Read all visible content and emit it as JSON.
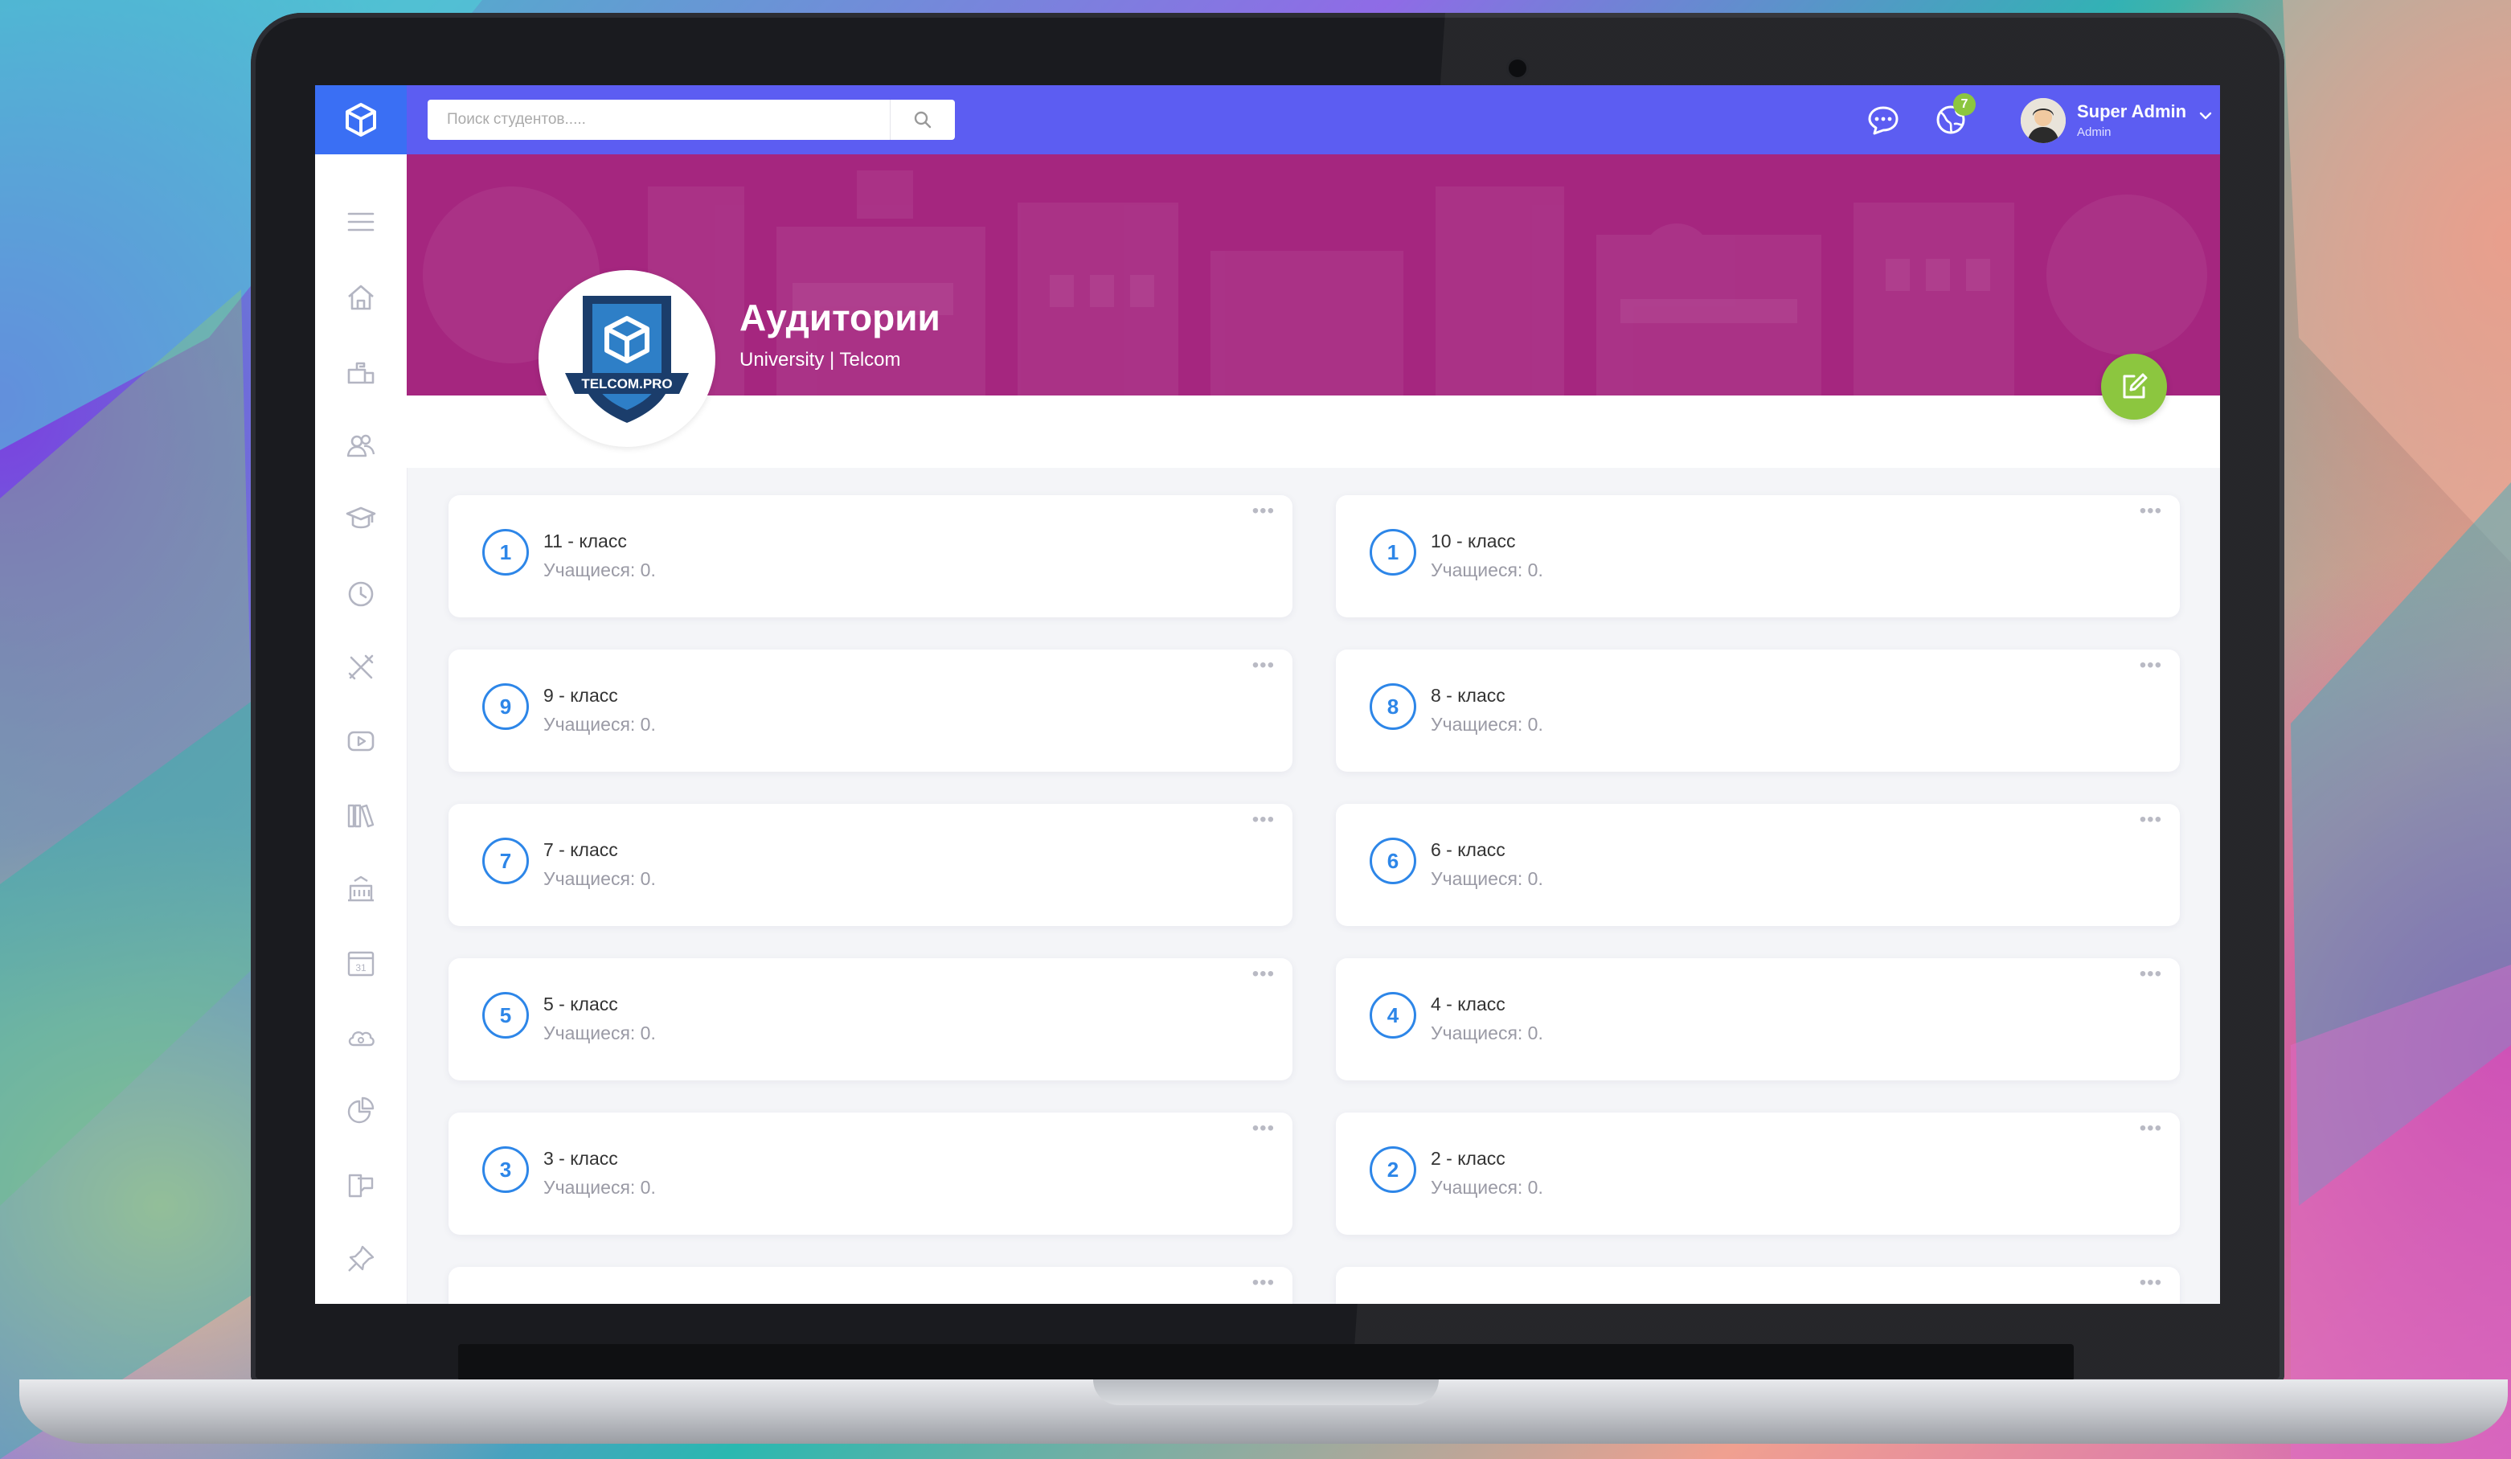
{
  "topbar": {
    "search_placeholder": "Поиск студентов.....",
    "notification_count": "7",
    "user_name": "Super Admin",
    "user_role": "Admin"
  },
  "sidebar": {
    "items": [
      {
        "icon": "menu-icon"
      },
      {
        "icon": "home-icon"
      },
      {
        "icon": "mailbox-icon"
      },
      {
        "icon": "users-icon"
      },
      {
        "icon": "graduation-cap-icon"
      },
      {
        "icon": "clock-icon"
      },
      {
        "icon": "tools-icon"
      },
      {
        "icon": "video-icon"
      },
      {
        "icon": "library-icon"
      },
      {
        "icon": "building-icon"
      },
      {
        "icon": "calendar-icon"
      },
      {
        "icon": "cloud-icon"
      },
      {
        "icon": "pie-chart-icon"
      },
      {
        "icon": "chat-icon"
      },
      {
        "icon": "pin-icon"
      }
    ]
  },
  "header": {
    "title": "Аудитории",
    "subtitle": "University | Telcom",
    "logo_text": "TELCOM.PRO"
  },
  "classes": [
    {
      "num": "1",
      "name": "11 - класс",
      "students": "Учащиеся: 0."
    },
    {
      "num": "1",
      "name": "10 - класс",
      "students": "Учащиеся: 0."
    },
    {
      "num": "9",
      "name": "9 - класс",
      "students": "Учащиеся: 0."
    },
    {
      "num": "8",
      "name": "8 - класс",
      "students": "Учащиеся: 0."
    },
    {
      "num": "7",
      "name": "7 - класс",
      "students": "Учащиеся: 0."
    },
    {
      "num": "6",
      "name": "6 - класс",
      "students": "Учащиеся: 0."
    },
    {
      "num": "5",
      "name": "5 - класс",
      "students": "Учащиеся: 0."
    },
    {
      "num": "4",
      "name": "4 - класс",
      "students": "Учащиеся: 0."
    },
    {
      "num": "3",
      "name": "3 - класс",
      "students": "Учащиеся: 0."
    },
    {
      "num": "2",
      "name": "2 - класс",
      "students": "Учащиеся: 0."
    }
  ],
  "colors": {
    "topbar": "#5c5df2",
    "banner": "#a5267f",
    "accent": "#2d86e8",
    "edit_button": "#8cc63f"
  }
}
